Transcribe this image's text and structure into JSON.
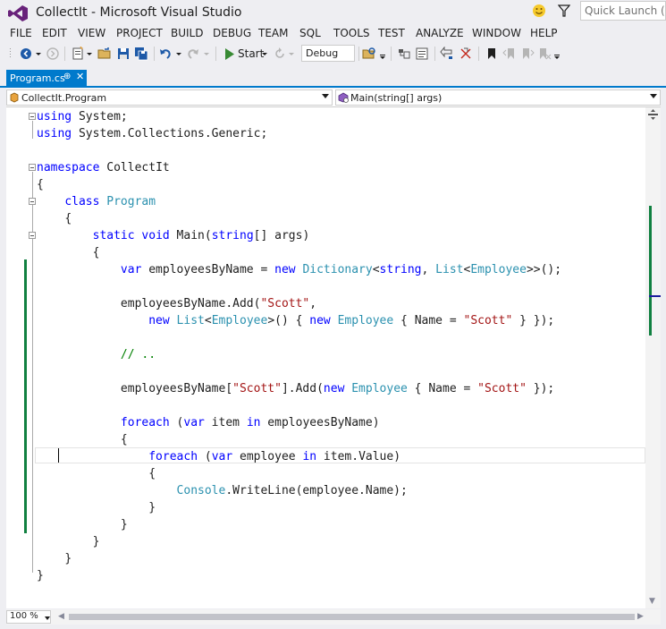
{
  "window": {
    "title": "CollectIt - Microsoft Visual Studio"
  },
  "quick_launch": {
    "placeholder": "Quick Launch (Ctrl+Q)"
  },
  "menu": [
    "FILE",
    "EDIT",
    "VIEW",
    "PROJECT",
    "BUILD",
    "DEBUG",
    "TEAM",
    "SQL",
    "TOOLS",
    "TEST",
    "ANALYZE",
    "WINDOW",
    "HELP"
  ],
  "toolbar": {
    "start_label": "Start",
    "configuration": "Debug"
  },
  "tab": {
    "label": "Program.cs",
    "pin": "⊕",
    "close": "✕"
  },
  "navbar": {
    "type_scope": "CollectIt.Program",
    "member_scope": "Main(string[] args)"
  },
  "zoom": "100 %",
  "colors": {
    "accent": "#007acc",
    "keyword": "#0000ff",
    "type": "#2b91af",
    "string": "#a31515",
    "comment": "#008000",
    "change_bar": "#108040"
  },
  "code": {
    "l1a": "using",
    "l1b": " System;",
    "l2a": "using",
    "l2b": " System.Collections.Generic;",
    "l4a": "namespace",
    "l4b": " CollectIt",
    "l5": "{",
    "l6a": "class",
    "l6b": "Program",
    "l7": "{",
    "l8a": "static",
    "l8b": "void",
    "l8c": " Main(",
    "l8d": "string",
    "l8e": "[] args)",
    "l9": "{",
    "l10a": "var",
    "l10b": " employeesByName = ",
    "l10c": "new",
    "l10d": "Dictionary",
    "l10e": "<",
    "l10f": "string",
    "l10g": ", ",
    "l10h": "List",
    "l10i": "<",
    "l10j": "Employee",
    "l10k": ">>();",
    "l12a": "employeesByName.Add(",
    "l12b": "\"Scott\"",
    "l12c": ",",
    "l13a": "new",
    "l13b": "List",
    "l13c": "<",
    "l13d": "Employee",
    "l13e": ">() { ",
    "l13f": "new",
    "l13g": "Employee",
    "l13h": " { Name = ",
    "l13i": "\"Scott\"",
    "l13j": " } });",
    "l15": "// ..",
    "l17a": "employeesByName[",
    "l17b": "\"Scott\"",
    "l17c": "].Add(",
    "l17d": "new",
    "l17e": "Employee",
    "l17f": " { Name = ",
    "l17g": "\"Scott\"",
    "l17h": " });",
    "l19a": "foreach",
    "l19b": " (",
    "l19c": "var",
    "l19d": " item ",
    "l19e": "in",
    "l19f": " employeesByName)",
    "l20": "{",
    "l21a": "foreach",
    "l21b": " (",
    "l21c": "var",
    "l21d": " employee ",
    "l21e": "in",
    "l21f": " item.Value)",
    "l22": "{",
    "l23a": "Console",
    "l23b": ".WriteLine(employee.Name);",
    "l24": "}",
    "l25": "}",
    "l26": "}",
    "l27": "}",
    "l28": "}"
  }
}
